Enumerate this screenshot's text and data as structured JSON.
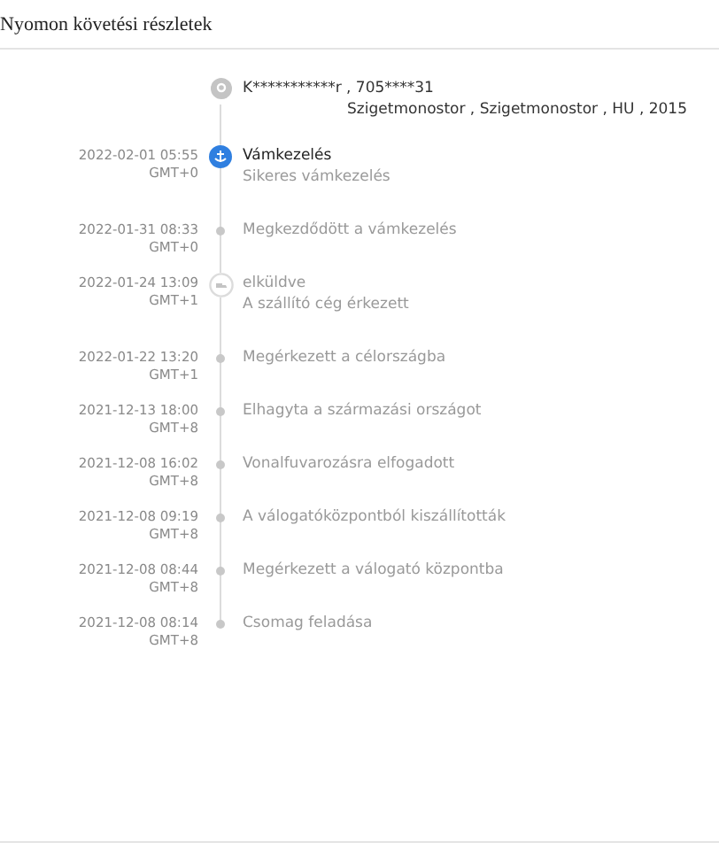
{
  "header": {
    "title": "Nyomon követési részletek"
  },
  "address": {
    "recipient": "K***********r ,  705****31",
    "location": "Szigetmonostor ,  Szigetmonostor ,  HU ,  2015"
  },
  "events": [
    {
      "kind": "current",
      "date": "2022-02-01 05:55",
      "timezone": "GMT+0",
      "title": "Vámkezelés",
      "detail": "Sikeres vámkezelés"
    },
    {
      "kind": "step",
      "date": "2022-01-31 08:33",
      "timezone": "GMT+0",
      "title": "Megkezdődött a vámkezelés"
    },
    {
      "kind": "shipped",
      "date": "2022-01-24 13:09",
      "timezone": "GMT+1",
      "title": "elküldve",
      "detail": "A szállító cég érkezett"
    },
    {
      "kind": "step",
      "date": "2022-01-22 13:20",
      "timezone": "GMT+1",
      "title": "Megérkezett a célországba"
    },
    {
      "kind": "step",
      "date": "2021-12-13 18:00",
      "timezone": "GMT+8",
      "title": "Elhagyta a származási országot"
    },
    {
      "kind": "step",
      "date": "2021-12-08 16:02",
      "timezone": "GMT+8",
      "title": "Vonalfuvarozásra elfogadott"
    },
    {
      "kind": "step",
      "date": "2021-12-08 09:19",
      "timezone": "GMT+8",
      "title": "A válogatóközpontból kiszállították"
    },
    {
      "kind": "step",
      "date": "2021-12-08 08:44",
      "timezone": "GMT+8",
      "title": "Megérkezett a válogató központba"
    },
    {
      "kind": "step",
      "date": "2021-12-08 08:14",
      "timezone": "GMT+8",
      "title": "Csomag feladása"
    }
  ]
}
